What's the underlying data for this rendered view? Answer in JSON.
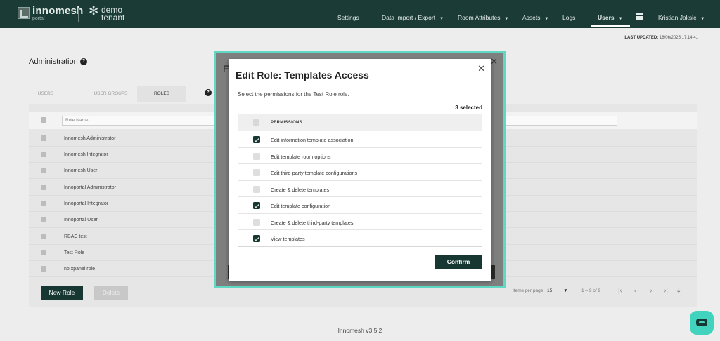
{
  "nav": {
    "brand": "innomesh",
    "brand_sub": "portal",
    "tenant": "demo tenant",
    "items": [
      {
        "label": "Settings",
        "dropdown": false
      },
      {
        "label": "Data Import / Export",
        "dropdown": true
      },
      {
        "label": "Room Attributes",
        "dropdown": true
      },
      {
        "label": "Assets",
        "dropdown": true
      },
      {
        "label": "Logs",
        "dropdown": false
      },
      {
        "label": "Users",
        "dropdown": true,
        "active": true
      }
    ],
    "user": "Kristian Jaksic",
    "apps_icon": "grid-icon"
  },
  "last_updated": {
    "label": "LAST UPDATED:",
    "value": "16/06/2025 17:14:41"
  },
  "admin": {
    "title": "Administration",
    "tabs": [
      "USERS",
      "USER GROUPS",
      "ROLES"
    ],
    "active_tab": "ROLES",
    "filter_placeholder": "Role Name",
    "roles": [
      "Innomesh Administrator",
      "Innomesh Integrator",
      "Innomesh User",
      "Innoportal Administrator",
      "Innoportal Integrator",
      "Innoportal User",
      "RBAC test",
      "Test Role",
      "no xpanel role"
    ],
    "new_button": "New Role",
    "delete_button": "Delete",
    "items_per_page_label": "Items per page",
    "items_per_page": "15",
    "range": "1 – 9 of 9"
  },
  "outer_modal": {
    "title": "E"
  },
  "modal": {
    "title": "Edit Role: Templates Access",
    "description": "Select the permissions for the Test Role role.",
    "selected_count": "3 selected",
    "column_header": "PERMISSIONS",
    "permissions": [
      {
        "label": "Edit information template association",
        "checked": true
      },
      {
        "label": "Edit template room options",
        "checked": false
      },
      {
        "label": "Edit third-party template configurations",
        "checked": false
      },
      {
        "label": "Create & delete templates",
        "checked": false
      },
      {
        "label": "Edit template configuration",
        "checked": true
      },
      {
        "label": "Create & delete third-party templates",
        "checked": false
      },
      {
        "label": "View templates",
        "checked": true
      }
    ],
    "confirm_label": "Confirm"
  },
  "footer": {
    "version": "Innomesh v3.5.2"
  },
  "colors": {
    "primary": "#173832",
    "accent": "#5fd9c4",
    "chat": "#41d3bd"
  }
}
